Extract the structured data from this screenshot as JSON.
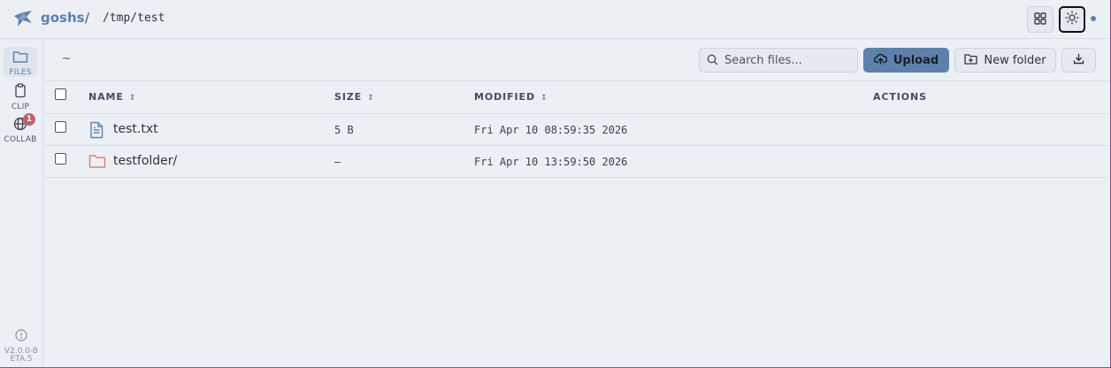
{
  "header": {
    "brand": "goshs",
    "separator": "/",
    "path": "/tmp/test",
    "grid_icon": "grid-icon",
    "theme_icon": "sun-icon"
  },
  "sidebar": {
    "items": [
      {
        "label": "FILES",
        "icon": "folder-icon",
        "active": true
      },
      {
        "label": "CLIP",
        "icon": "clipboard-icon",
        "active": false
      },
      {
        "label": "COLLAB",
        "icon": "globe-icon",
        "active": false,
        "badge": "1"
      }
    ],
    "version": "v2.0.0-beta.5"
  },
  "toolbar": {
    "home": "~",
    "search_placeholder": "Search files...",
    "upload_label": "Upload",
    "new_folder_label": "New folder"
  },
  "table": {
    "columns": [
      {
        "label": "NAME",
        "sortable": true
      },
      {
        "label": "SIZE",
        "sortable": true
      },
      {
        "label": "MODIFIED",
        "sortable": true
      },
      {
        "label": "ACTIONS",
        "sortable": false
      }
    ],
    "sort_glyph": "↕",
    "rows": [
      {
        "name": "test.txt",
        "type": "file",
        "size": "5 B",
        "modified": "Fri Apr 10 08:59:35 2026"
      },
      {
        "name": "testfolder/",
        "type": "folder",
        "size": "—",
        "modified": "Fri Apr 10 13:59:50 2026"
      }
    ]
  },
  "colors": {
    "accent": "#5e81ac",
    "background": "#eceff4",
    "folder": "#d08770",
    "badge": "#bf616a"
  }
}
